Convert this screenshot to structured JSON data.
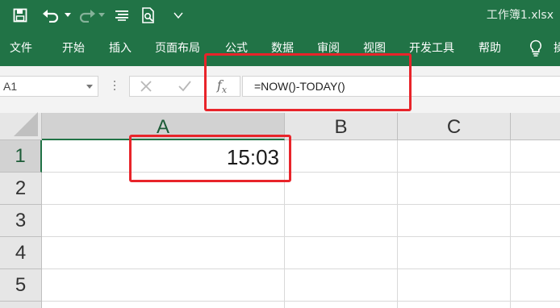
{
  "app": {
    "doc_title": "工作簿1.xlsx",
    "accent_color": "#217346",
    "highlight_color": "#e8242a"
  },
  "quick_access": {
    "icons": [
      "save-icon",
      "undo-icon",
      "undo-dropdown-icon",
      "redo-icon",
      "redo-dropdown-icon",
      "form-icon",
      "print-preview-icon",
      "customize-dropdown-icon"
    ]
  },
  "ribbon": {
    "tabs": [
      "文件",
      "开始",
      "插入",
      "页面布局",
      "公式",
      "数据",
      "审阅",
      "视图",
      "开发工具",
      "帮助"
    ],
    "tell_me_icon": "lightbulb-icon",
    "truncated_tab": "操"
  },
  "formula_bar": {
    "name_box": "A1",
    "cancel_icon": "close-icon",
    "enter_icon": "checkmark-icon",
    "fx_label": "f",
    "fx_sub": "x",
    "formula": "=NOW()-TODAY()"
  },
  "sheet": {
    "columns": [
      "A",
      "B",
      "C"
    ],
    "rows": [
      "1",
      "2",
      "3",
      "4",
      "5"
    ],
    "cells": {
      "A1": "15:03"
    }
  }
}
